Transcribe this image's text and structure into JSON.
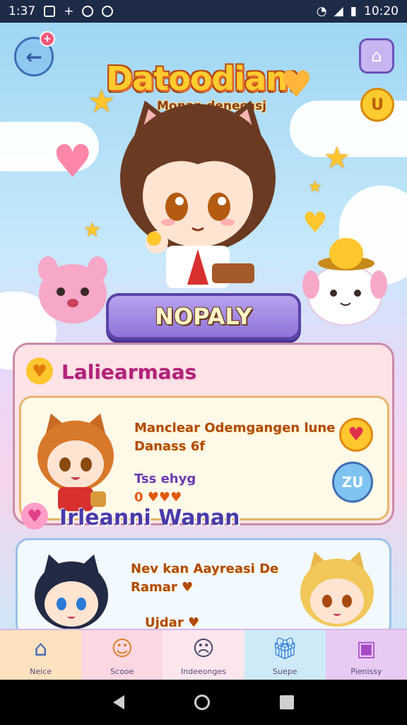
{
  "status_bar": {
    "time_left": "1:37",
    "time_right": "10:20"
  },
  "header": {
    "logo_text": "Datoodiam",
    "subtitle": "Monan denecasj"
  },
  "main": {
    "play_button_label": "NOPALY"
  },
  "section_one": {
    "title": "Laliearmaas",
    "card": {
      "line1": "Manclear Odemgangen lune",
      "line2": "Danass 6f",
      "line3": "Tss ehyg",
      "line4": "0 ♥♥♥",
      "badge": "ZU"
    }
  },
  "section_two": {
    "title": "Irleanni Wanan",
    "card": {
      "line1": "Nev kan Aayreasi De",
      "line2": "Ramar ♥",
      "line3": "Ujdar ♥"
    }
  },
  "bottom_nav": {
    "items": [
      {
        "label": "Neice",
        "icon": "home-icon"
      },
      {
        "label": "Scooe",
        "icon": "bread-icon"
      },
      {
        "label": "Indeeonges",
        "icon": "face-icon"
      },
      {
        "label": "Suepe",
        "icon": "gift-icon"
      },
      {
        "label": "Pienissy",
        "icon": "box-icon"
      }
    ]
  },
  "colors": {
    "status_bar_bg": "#1d2b49",
    "panel_bg": "#fde3e6",
    "card_bg": "#fff9e8",
    "accent_purple": "#8f73d8",
    "accent_orange": "#ffcb2e"
  }
}
